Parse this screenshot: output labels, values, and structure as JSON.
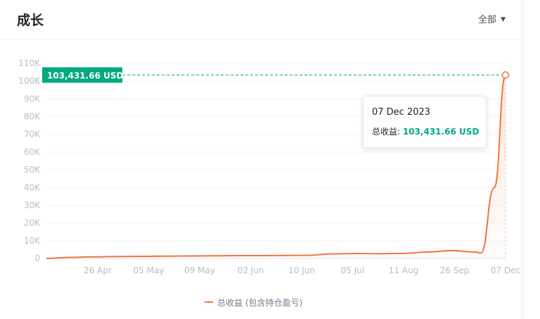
{
  "header": {
    "title": "成长",
    "filter_label": "全部",
    "filter_icon": "caret-down-icon"
  },
  "tooltip": {
    "date": "07 Dec 2023",
    "label": "总收益:",
    "value": "103,431.66 USD"
  },
  "colors": {
    "line": "#f0743f",
    "accent": "#02a880",
    "grid": "#f3f3f3",
    "axis_text": "#b7bdc6"
  },
  "chart_data": {
    "type": "area",
    "ylim": [
      0,
      110000
    ],
    "y_ticks": [
      0,
      10000,
      20000,
      30000,
      40000,
      50000,
      60000,
      70000,
      80000,
      90000,
      100000,
      110000
    ],
    "y_tick_labels": [
      "0",
      "10K",
      "20K",
      "30K",
      "40K",
      "50K",
      "60K",
      "70K",
      "80K",
      "90K",
      "100K",
      "110K"
    ],
    "x_tick_labels": [
      "26 Apr",
      "05 May",
      "09 May",
      "02 Jun",
      "10 Jun",
      "05 Jul",
      "11 Aug",
      "26 Sep",
      "07 Dec"
    ],
    "current_value_label": "103,431.66 USD",
    "series": [
      {
        "name": "总收益 (包含持仓盈亏)",
        "values": [
          0,
          600,
          900,
          1100,
          1200,
          1300,
          1400,
          1500,
          1600,
          1600,
          1700,
          1800,
          2600,
          2800,
          2700,
          2900,
          3600,
          4400,
          3600,
          3100,
          40000,
          103431.66
        ]
      }
    ]
  }
}
